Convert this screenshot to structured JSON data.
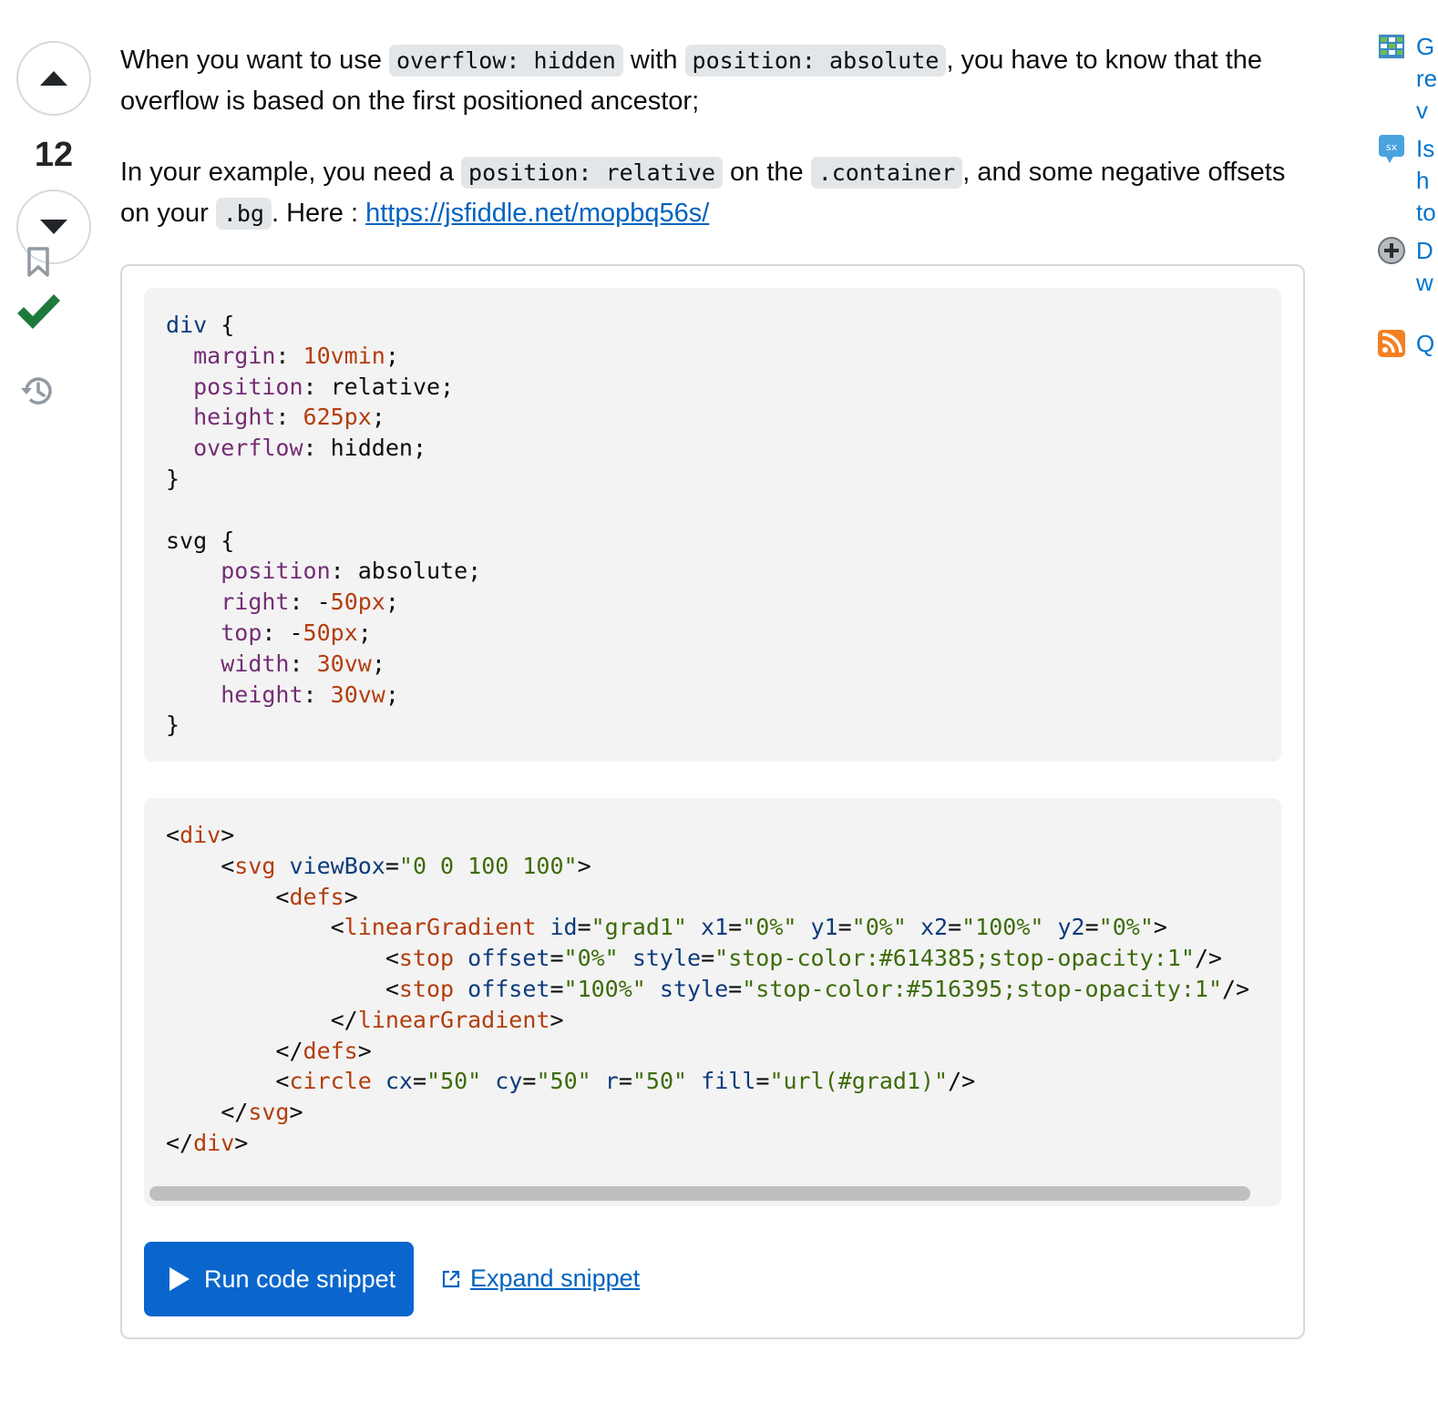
{
  "vote": {
    "score": "12"
  },
  "post": {
    "p1": {
      "t1": "When you want to use ",
      "c1": "overflow: hidden",
      "t2": " with ",
      "c2": "position: absolute",
      "t3": ", you have to know that the overflow is based on the first positioned ancestor;"
    },
    "p2": {
      "t1": "In your example, you need a ",
      "c1": "position: relative",
      "t2": " on the ",
      "c2": ".container",
      "t3": ", and some negative offsets on your ",
      "c3": ".bg",
      "t4": ". Here : ",
      "link": "https://jsfiddle.net/mopbq56s/"
    }
  },
  "snippet": {
    "run_label": "Run code snippet",
    "expand_label": "Expand snippet"
  },
  "sidebar": [
    {
      "icon": "spreadsheet-icon",
      "lines": [
        "G",
        "re",
        "v"
      ]
    },
    {
      "icon": "sx-chat-icon",
      "lines": [
        "Is",
        "h",
        "to"
      ]
    },
    {
      "icon": "plus-circle-icon",
      "lines": [
        "D",
        "w"
      ]
    },
    {
      "icon": "rss-icon",
      "lines": [
        "Q"
      ]
    }
  ],
  "colors": {
    "accent": "#0a66cc",
    "link": "#0063bf",
    "accepted": "#2f6f44"
  }
}
